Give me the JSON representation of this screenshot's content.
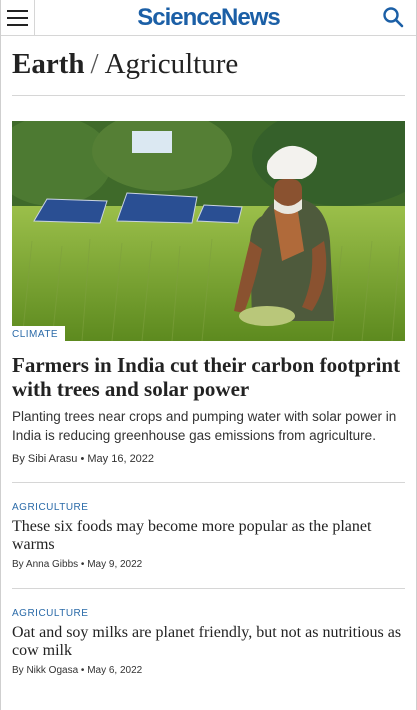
{
  "header": {
    "logo": "ScienceNews",
    "menu_icon": "hamburger-menu-icon",
    "search_icon": "search-icon"
  },
  "breadcrumb": {
    "section": "Earth",
    "separator": "/",
    "subsection": "Agriculture"
  },
  "lead": {
    "tag": "CLIMATE",
    "title": "Farmers in India cut their carbon footprint with trees and solar power",
    "summary": "Planting trees near crops and pumping water with solar power in India is reducing greenhouse gas emissions from agriculture.",
    "byline": "By Sibi Arasu • May 16, 2022"
  },
  "articles": [
    {
      "tag": "AGRICULTURE",
      "title": "These six foods may become more popular as the planet warms",
      "byline": "By Anna Gibbs • May 9, 2022"
    },
    {
      "tag": "AGRICULTURE",
      "title": "Oat and soy milks are planet friendly, but not as nutritious as cow milk",
      "byline": "By Nikk Ogasa • May 6, 2022"
    }
  ],
  "colors": {
    "brand": "#1b5fa6",
    "tag": "#2a6aa8",
    "divider": "#d6d6d6"
  }
}
